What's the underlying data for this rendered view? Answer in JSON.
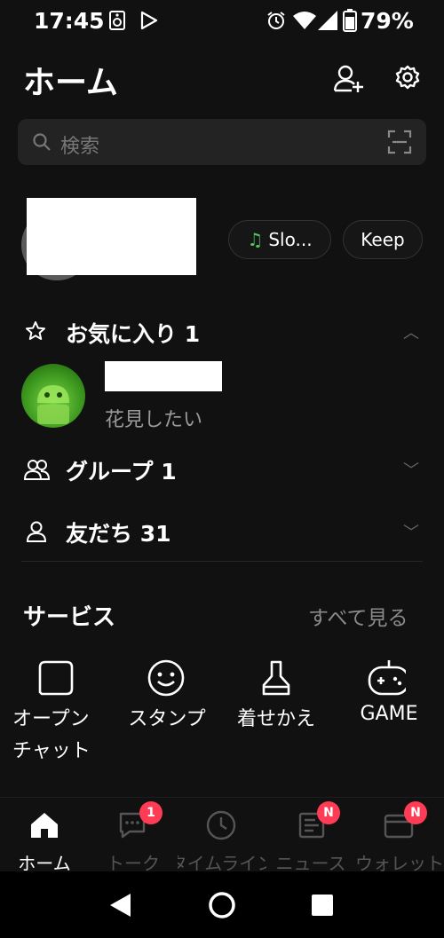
{
  "status_bar": {
    "time": "17:45",
    "battery": "79%"
  },
  "header": {
    "title": "ホーム"
  },
  "search": {
    "placeholder": "検索"
  },
  "profile": {
    "music_label": "Slo...",
    "keep_label": "Keep"
  },
  "favorites": {
    "title": "お気に入り 1",
    "item_status": "花見したい"
  },
  "groups": {
    "title": "グループ 1"
  },
  "friends": {
    "title": "友だち 31"
  },
  "services": {
    "title": "サービス",
    "see_all": "すべて見る",
    "items": [
      {
        "label_line1": "オープン",
        "label_line2": "チャット",
        "icon": "open-chat-icon"
      },
      {
        "label_line1": "スタンプ",
        "icon": "sticker-smile-icon"
      },
      {
        "label_line1": "着せかえ",
        "icon": "theme-brush-icon"
      },
      {
        "label_line1": "GAME",
        "icon": "game-controller-icon"
      }
    ]
  },
  "bottom_nav": {
    "items": [
      {
        "label": "ホーム",
        "icon": "home-icon",
        "active": true
      },
      {
        "label": "トーク",
        "icon": "chat-bubble-icon",
        "badge": "1"
      },
      {
        "label": "タイムライン",
        "icon": "clock-icon"
      },
      {
        "label": "ニュース",
        "icon": "news-icon",
        "badge": "N"
      },
      {
        "label": "ウォレット",
        "icon": "wallet-icon",
        "badge": "N"
      }
    ]
  },
  "colors": {
    "background": "#111111",
    "accent_green": "#4cc764",
    "badge_red": "#ff3b55"
  }
}
